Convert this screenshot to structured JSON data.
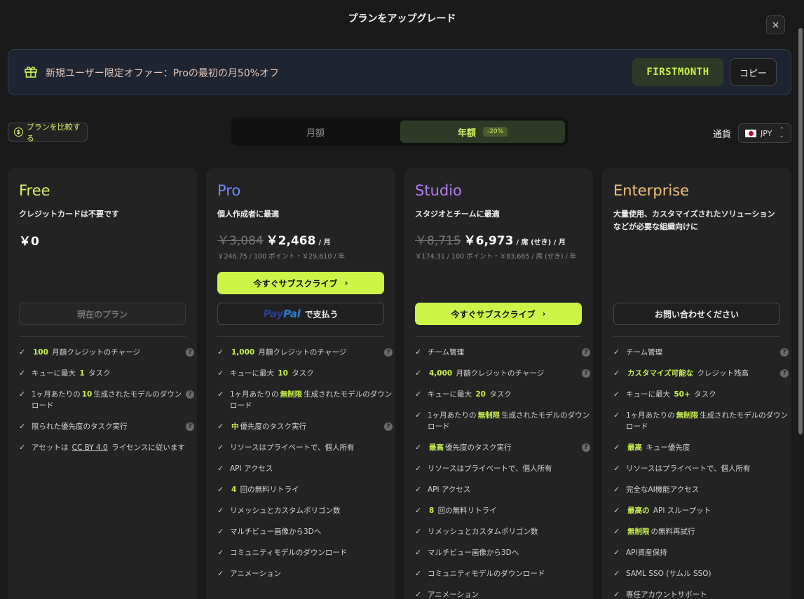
{
  "dialog": {
    "title": "プランをアップグレード",
    "close_label": "×"
  },
  "promo": {
    "message": "新規ユーザー限定オファー：Proの最初の月50%オフ",
    "code": "FIRSTMONTH",
    "copy_label": "コピー"
  },
  "compare_label": "プランを比較する",
  "billing": {
    "monthly": "月額",
    "yearly": "年額",
    "discount": "-20%",
    "selected": "yearly"
  },
  "currency": {
    "label": "通貨",
    "value": "JPY"
  },
  "plans": {
    "free": {
      "name": "Free",
      "subtitle": "クレジットカードは不要です",
      "price": "￥0",
      "button": "現在のプラン",
      "features": [
        {
          "pre": "",
          "hl": "100",
          "post": " 月額クレジットのチャージ",
          "help": true
        },
        {
          "pre": "キューに最大 ",
          "hl": "1",
          "post": " タスク",
          "help": false
        },
        {
          "pre": "1ヶ月あたりの",
          "hl": "10",
          "post": "生成されたモデルのダウンロード",
          "help": true
        },
        {
          "pre": "限られた優先度のタスク実行",
          "hl": "",
          "post": "",
          "help": true
        },
        {
          "pre": "アセットは ",
          "ul": "CC BY 4.0",
          "post": " ライセンスに従います",
          "help": false
        }
      ]
    },
    "pro": {
      "name": "Pro",
      "subtitle": "個人作成者に最適",
      "old_price": "￥3,084",
      "price": "￥2,468",
      "per": "/ 月",
      "detail": "￥246.75 / 100 ポイント・￥29,610 / 年",
      "button": "今すぐサブスクライブ",
      "paypal_a": "Pay",
      "paypal_b": "Pal",
      "paypal_suffix": "で支払う",
      "features": [
        {
          "pre": "",
          "hl": "1,000",
          "post": " 月額クレジットのチャージ",
          "help": true
        },
        {
          "pre": "キューに最大 ",
          "hl": "10",
          "post": " タスク",
          "help": false
        },
        {
          "pre": "1ヶ月あたりの",
          "hl": "無制限",
          "post": "生成されたモデルのダウンロード",
          "help": false
        },
        {
          "pre": "",
          "hl": "中",
          "post": "優先度のタスク実行",
          "help": true
        },
        {
          "pre": "リソースはプライベートで、個人所有",
          "hl": "",
          "post": "",
          "help": false
        },
        {
          "pre": "API アクセス",
          "hl": "",
          "post": "",
          "help": false
        },
        {
          "pre": "",
          "hl": "4",
          "post": " 回の無料リトライ",
          "help": false
        },
        {
          "pre": "リメッシュとカスタムポリゴン数",
          "hl": "",
          "post": "",
          "help": false
        },
        {
          "pre": "マルチビュー画像から3Dへ",
          "hl": "",
          "post": "",
          "help": false
        },
        {
          "pre": "コミュニティモデルのダウンロード",
          "hl": "",
          "post": "",
          "help": false
        },
        {
          "pre": "アニメーション",
          "hl": "",
          "post": "",
          "help": false
        }
      ]
    },
    "studio": {
      "name": "Studio",
      "subtitle": "スタジオとチームに最適",
      "old_price": "￥8,715",
      "price": "￥6,973",
      "per": "/ 席 (せき) / 月",
      "detail": "￥174.31 / 100 ポイント・￥83,665 / 席 (せき) / 年",
      "button": "今すぐサブスクライブ",
      "features": [
        {
          "pre": "チーム管理",
          "hl": "",
          "post": "",
          "help": true
        },
        {
          "pre": "",
          "hl": "4,000",
          "post": " 月額クレジットのチャージ",
          "help": true
        },
        {
          "pre": "キューに最大 ",
          "hl": "20",
          "post": " タスク",
          "help": false
        },
        {
          "pre": "1ヶ月あたりの",
          "hl": "無制限",
          "post": "生成されたモデルのダウンロード",
          "help": false
        },
        {
          "pre": "",
          "hl": "最高",
          "post": "優先度のタスク実行",
          "help": true
        },
        {
          "pre": "リソースはプライベートで、個人所有",
          "hl": "",
          "post": "",
          "help": false
        },
        {
          "pre": "API アクセス",
          "hl": "",
          "post": "",
          "help": false
        },
        {
          "pre": "",
          "hl": "8",
          "post": " 回の無料リトライ",
          "help": false
        },
        {
          "pre": "リメッシュとカスタムポリゴン数",
          "hl": "",
          "post": "",
          "help": false
        },
        {
          "pre": "マルチビュー画像から3Dへ",
          "hl": "",
          "post": "",
          "help": false
        },
        {
          "pre": "コミュニティモデルのダウンロード",
          "hl": "",
          "post": "",
          "help": false
        },
        {
          "pre": "アニメーション",
          "hl": "",
          "post": "",
          "help": false
        }
      ]
    },
    "enterprise": {
      "name": "Enterprise",
      "subtitle": "大量使用、カスタマイズされたソリューションなどが必要な組織向けに",
      "button": "お問い合わせください",
      "features": [
        {
          "pre": "チーム管理",
          "hl": "",
          "post": "",
          "help": true
        },
        {
          "pre": "",
          "hl": "カスタマイズ可能な",
          "post": " クレジット残高",
          "help": true
        },
        {
          "pre": "キューに最大 ",
          "hl": "50+",
          "post": " タスク",
          "help": false
        },
        {
          "pre": "1ヶ月あたりの",
          "hl": "無制限",
          "post": "生成されたモデルのダウンロード",
          "help": false
        },
        {
          "pre": "",
          "hl": "最高",
          "post": " キュー優先度",
          "help": false
        },
        {
          "pre": "リソースはプライベートで、個人所有",
          "hl": "",
          "post": "",
          "help": false
        },
        {
          "pre": "完全なAI機能アクセス",
          "hl": "",
          "post": "",
          "help": false
        },
        {
          "pre": "",
          "hl": "最高の",
          "post": " API スループット",
          "help": false
        },
        {
          "pre": "",
          "hl": "無制限",
          "post": "の無料再試行",
          "help": false
        },
        {
          "pre": "API資産保持",
          "hl": "",
          "post": "",
          "help": false
        },
        {
          "pre": "SAML SSO (サムル SSO)",
          "hl": "",
          "post": "",
          "help": false
        },
        {
          "pre": "専任アカウントサポート",
          "hl": "",
          "post": "",
          "help": false
        }
      ]
    }
  },
  "colors": {
    "accent": "#cdf548",
    "free": "#d8f26a",
    "pro": "#6b8cff",
    "studio": "#b77cf0",
    "enterprise": "#f5c278"
  }
}
